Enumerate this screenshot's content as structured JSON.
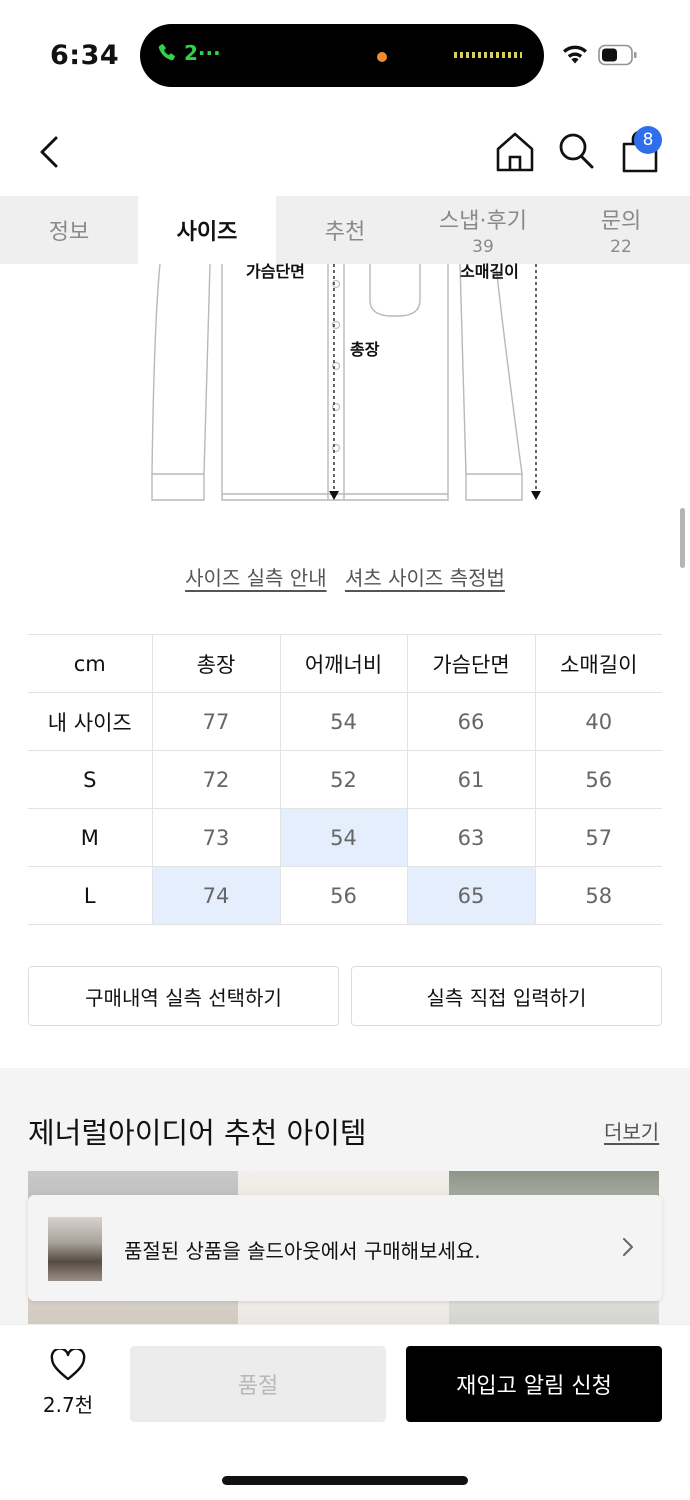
{
  "status_bar": {
    "time": "6:34",
    "call_indicator": "2···"
  },
  "header": {
    "cart_count": "8"
  },
  "tabs": [
    {
      "label": "정보",
      "count": ""
    },
    {
      "label": "사이즈",
      "count": ""
    },
    {
      "label": "추천",
      "count": ""
    },
    {
      "label": "스냅·후기",
      "count": "39"
    },
    {
      "label": "문의",
      "count": "22"
    }
  ],
  "diagram": {
    "chest_label": "가슴단면",
    "length_label": "총장",
    "sleeve_label": "소매길이"
  },
  "size_links": {
    "guide": "사이즈 실측 안내",
    "method": "셔츠 사이즈 측정법"
  },
  "size_table": {
    "headers": [
      "cm",
      "총장",
      "어깨너비",
      "가슴단면",
      "소매길이"
    ],
    "rows": [
      [
        "내 사이즈",
        "77",
        "54",
        "66",
        "40"
      ],
      [
        "S",
        "72",
        "52",
        "61",
        "56"
      ],
      [
        "M",
        "73",
        "54",
        "63",
        "57"
      ],
      [
        "L",
        "74",
        "56",
        "65",
        "58"
      ]
    ]
  },
  "actions": {
    "select_history": "구매내역 실측 선택하기",
    "direct_input": "실측 직접 입력하기"
  },
  "recommend": {
    "title": "제너럴아이디어 추천 아이템",
    "more": "더보기"
  },
  "soldout_banner": {
    "text": "품절된 상품을 솔드아웃에서 구매해보세요."
  },
  "bottom_bar": {
    "likes": "2.7천",
    "soldout_label": "품절",
    "restock_label": "재입고 알림 신청"
  },
  "colors": {
    "accent_blue": "#2f6fea",
    "highlight": "#e4eefc",
    "primary_button": "#000000"
  }
}
